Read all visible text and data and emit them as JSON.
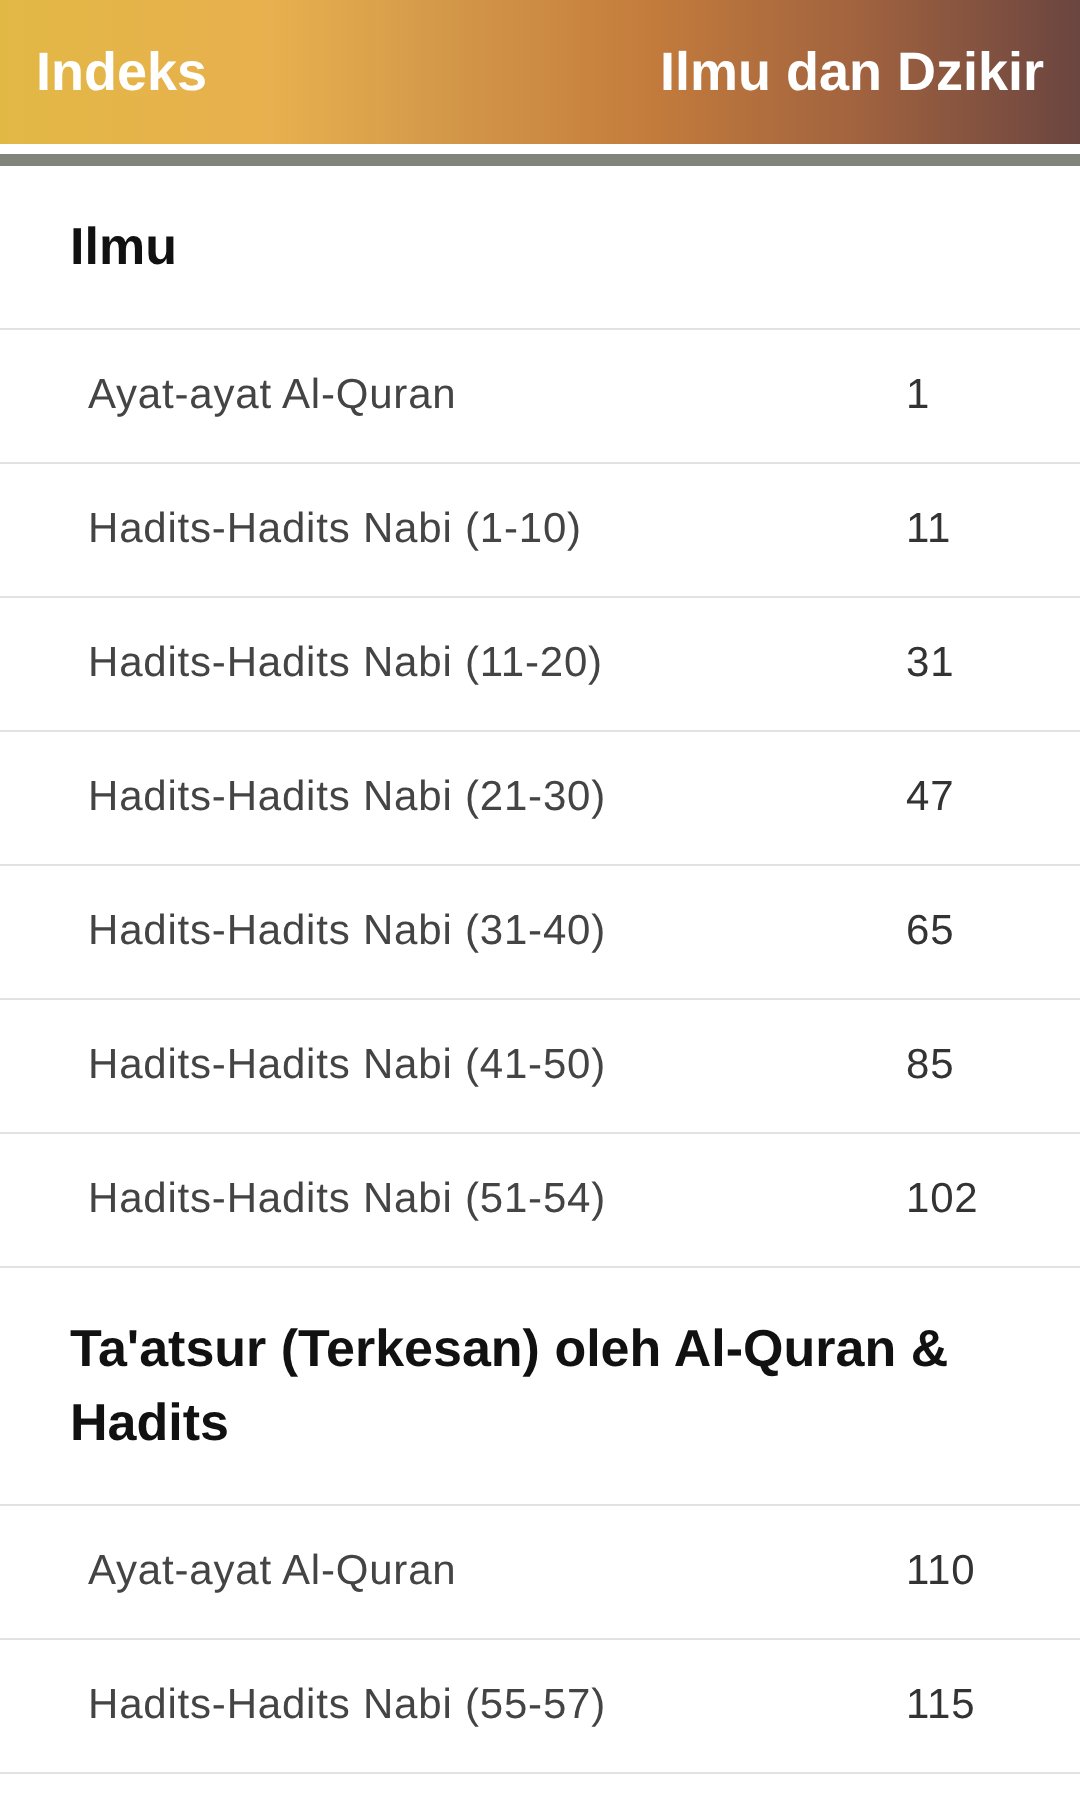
{
  "header": {
    "left_title": "Indeks",
    "right_title": "Ilmu dan Dzikir"
  },
  "sections": [
    {
      "title": "Ilmu",
      "entries": [
        {
          "label": "Ayat-ayat Al-Quran",
          "page": "1"
        },
        {
          "label": "Hadits-Hadits Nabi (1-10)",
          "page": "11"
        },
        {
          "label": "Hadits-Hadits Nabi (11-20)",
          "page": "31"
        },
        {
          "label": "Hadits-Hadits Nabi (21-30)",
          "page": "47"
        },
        {
          "label": "Hadits-Hadits Nabi (31-40)",
          "page": "65"
        },
        {
          "label": "Hadits-Hadits Nabi (41-50)",
          "page": "85"
        },
        {
          "label": "Hadits-Hadits Nabi (51-54)",
          "page": "102"
        }
      ]
    },
    {
      "title": "Ta'atsur (Terkesan) oleh Al-Quran & Hadits",
      "entries": [
        {
          "label": "Ayat-ayat Al-Quran",
          "page": "110"
        },
        {
          "label": "Hadits-Hadits Nabi (55-57)",
          "page": "115"
        }
      ]
    }
  ]
}
